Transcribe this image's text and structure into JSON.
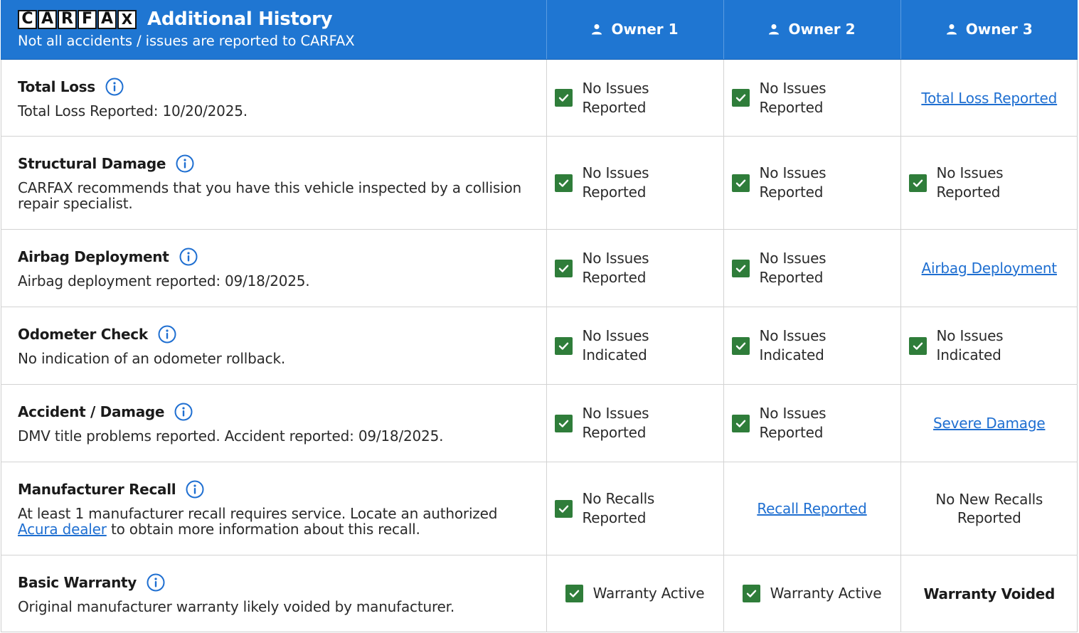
{
  "header": {
    "logo_letters": [
      "C",
      "A",
      "R",
      "F",
      "A",
      "X"
    ],
    "title": "Additional History",
    "subtitle": "Not all accidents / issues are reported to CARFAX",
    "owners": [
      "Owner 1",
      "Owner 2",
      "Owner 3"
    ]
  },
  "icons": {
    "owner": "person-icon",
    "info": "info-icon",
    "status_ok": "checkmark-icon"
  },
  "colors": {
    "header_bg": "#1f76d2",
    "check_bg": "#2f7d3a",
    "link": "#1f6fd1"
  },
  "rows": [
    {
      "title": "Total Loss",
      "desc": "Total Loss Reported: 10/20/2025.",
      "cells": [
        {
          "type": "check",
          "text": "No Issues Reported"
        },
        {
          "type": "check",
          "text": "No Issues Reported"
        },
        {
          "type": "link",
          "text": "Total Loss Reported"
        }
      ]
    },
    {
      "title": "Structural Damage",
      "desc": "CARFAX recommends that you have this vehicle inspected by a collision repair specialist.",
      "cells": [
        {
          "type": "check",
          "text": "No Issues Reported"
        },
        {
          "type": "check",
          "text": "No Issues Reported"
        },
        {
          "type": "check",
          "text": "No Issues Reported"
        }
      ]
    },
    {
      "title": "Airbag Deployment",
      "desc": "Airbag deployment reported: 09/18/2025.",
      "cells": [
        {
          "type": "check",
          "text": "No Issues Reported"
        },
        {
          "type": "check",
          "text": "No Issues Reported"
        },
        {
          "type": "link",
          "text": "Airbag Deployment"
        }
      ]
    },
    {
      "title": "Odometer Check",
      "desc": "No indication of an odometer rollback.",
      "cells": [
        {
          "type": "check",
          "text": "No Issues Indicated"
        },
        {
          "type": "check",
          "text": "No Issues Indicated"
        },
        {
          "type": "check",
          "text": "No Issues Indicated"
        }
      ]
    },
    {
      "title": "Accident / Damage",
      "desc": "DMV title problems reported. Accident reported: 09/18/2025.",
      "cells": [
        {
          "type": "check",
          "text": "No Issues Reported"
        },
        {
          "type": "check",
          "text": "No Issues Reported"
        },
        {
          "type": "link",
          "text": "Severe Damage"
        }
      ]
    },
    {
      "title": "Manufacturer Recall",
      "desc_pre": "At least 1 manufacturer recall requires service. Locate an authorized",
      "desc_link": "Acura dealer",
      "desc_post": "to obtain more information about this recall.",
      "cells": [
        {
          "type": "check",
          "text": "No Recalls Reported"
        },
        {
          "type": "link",
          "text": "Recall Reported"
        },
        {
          "type": "plain",
          "text": "No New Recalls Reported"
        }
      ]
    },
    {
      "title": "Basic Warranty",
      "desc": "Original manufacturer warranty likely voided by manufacturer.",
      "cells": [
        {
          "type": "check-single",
          "text": "Warranty Active"
        },
        {
          "type": "check-single",
          "text": "Warranty Active"
        },
        {
          "type": "bold",
          "text": "Warranty Voided"
        }
      ]
    }
  ]
}
